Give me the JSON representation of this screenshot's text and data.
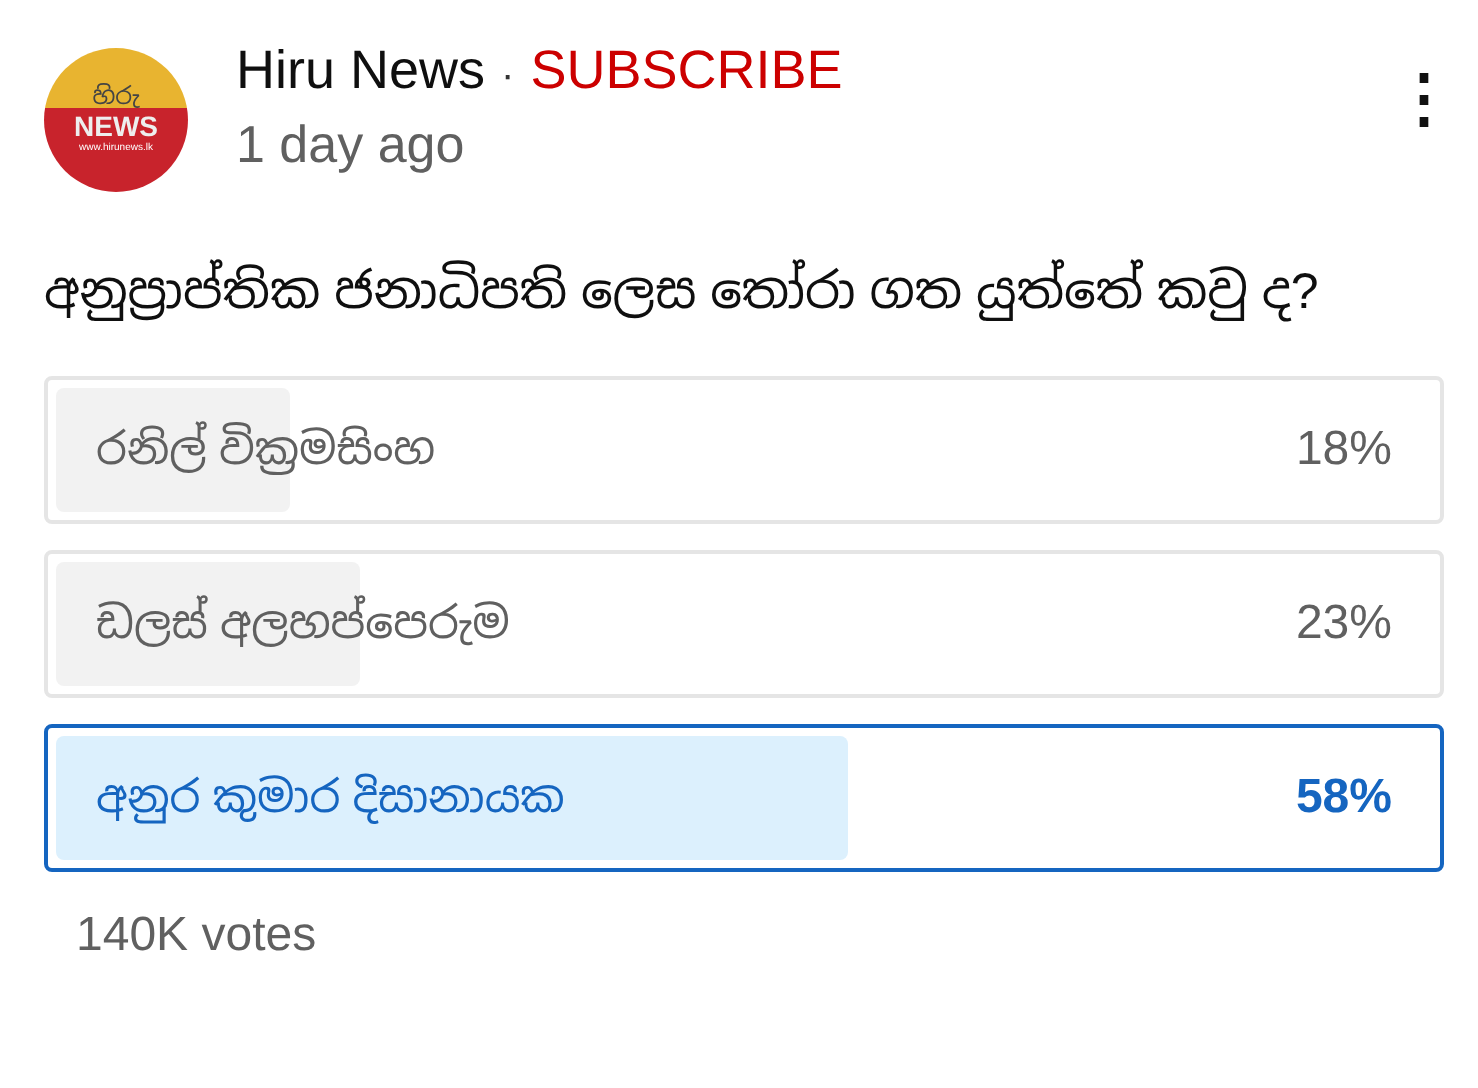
{
  "channel": {
    "logo": {
      "top": "හිරු",
      "middle": "NEWS",
      "bottom": "www.hirunews.lk"
    },
    "name": "Hiru News",
    "separator": "·",
    "subscribe": "SUBSCRIBE",
    "time": "1 day ago"
  },
  "menu": {
    "icon": "⋮"
  },
  "poll": {
    "question": "අනුප්‍රාප්තික ජනාධිපති ලෙස තෝරා ගත යුත්තේ කවු ද?",
    "options": [
      {
        "label": "රනිල් වික්‍රමසිංහ",
        "percent": "18%",
        "level": 0.18,
        "selected": false
      },
      {
        "label": "ඩලස් අලහප්පෙරුම",
        "percent": "23%",
        "level": 0.23,
        "selected": false
      },
      {
        "label": "අනුර කුමාර දිසානායක",
        "percent": "58%",
        "level": 0.58,
        "selected": true
      }
    ],
    "votes": "140K votes"
  }
}
